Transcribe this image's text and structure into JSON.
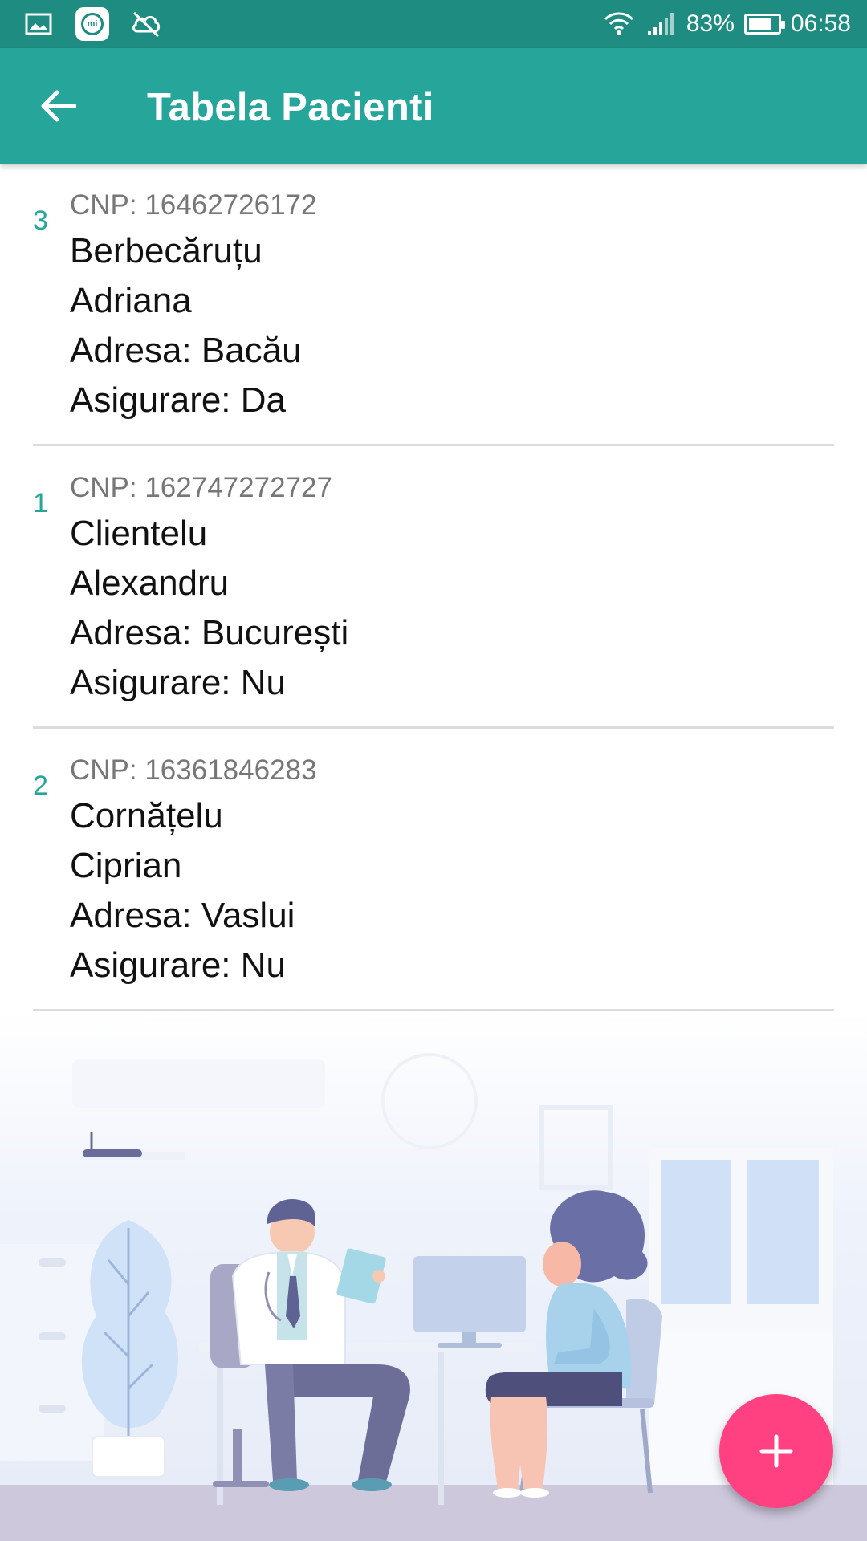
{
  "status_bar": {
    "battery_percent": "83%",
    "battery_level": 0.83,
    "time": "06:58",
    "icons": [
      "gallery-icon",
      "mi-app-icon",
      "sync-off-icon",
      "wifi-icon",
      "signal-icon",
      "battery-icon"
    ]
  },
  "app_bar": {
    "title": "Tabela Pacienti",
    "back_icon": "arrow-back-icon",
    "color": "#26a69a"
  },
  "patients": [
    {
      "id": "3",
      "cnp": "CNP: 16462726172",
      "last_name": "Berbecăruțu",
      "first_name": "Adriana",
      "address": "Adresa: Bacău",
      "insurance": "Asigurare: Da"
    },
    {
      "id": "1",
      "cnp": "CNP: 162747272727",
      "last_name": "Clientelu",
      "first_name": "Alexandru",
      "address": "Adresa: București",
      "insurance": "Asigurare: Nu"
    },
    {
      "id": "2",
      "cnp": "CNP: 16361846283",
      "last_name": "Cornățelu",
      "first_name": "Ciprian",
      "address": "Adresa: Vaslui",
      "insurance": "Asigurare: Nu"
    }
  ],
  "fab": {
    "icon": "plus-icon",
    "color": "#ff4081"
  },
  "colors": {
    "status_bar": "#1e8c80",
    "primary": "#26a69a",
    "accent": "#ff4081"
  }
}
